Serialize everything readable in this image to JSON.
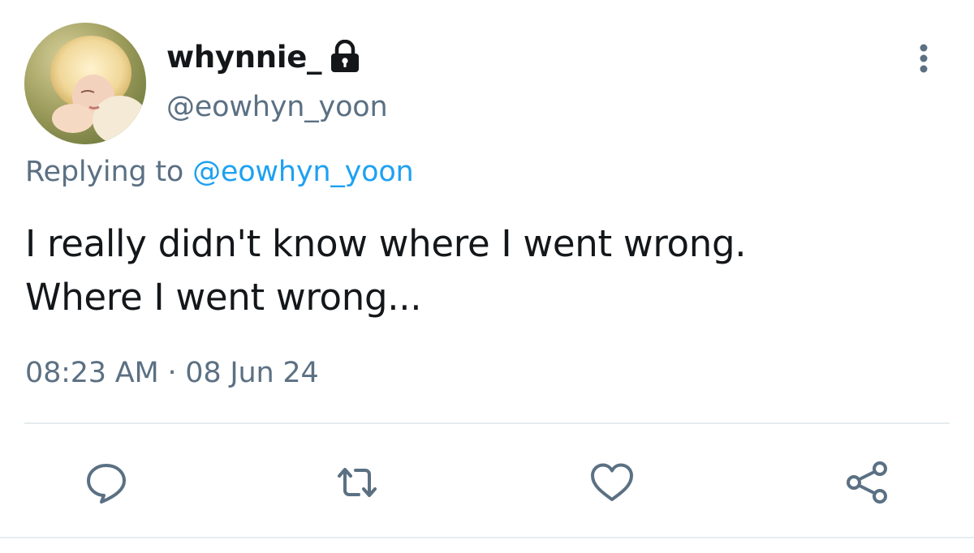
{
  "user": {
    "display_name": "whynnie_",
    "handle": "@eowhyn_yoon",
    "locked": true,
    "avatar_icon": "profile-photo"
  },
  "reply": {
    "prefix": "Replying to",
    "mention": "@eowhyn_yoon"
  },
  "tweet": {
    "lines": [
      "I really didn't know where I went wrong.",
      "Where I went wrong..."
    ],
    "timestamp": "08:23 AM · 08 Jun 24"
  },
  "icons": {
    "more": "more-vertical-icon",
    "reply": "comment-icon",
    "retweet": "retweet-icon",
    "like": "heart-icon",
    "share": "share-icon",
    "lock": "lock-icon"
  },
  "colors": {
    "text_primary": "#14171a",
    "text_secondary": "#5b7083",
    "link": "#1da1f2",
    "divider": "#e6ecf0"
  }
}
